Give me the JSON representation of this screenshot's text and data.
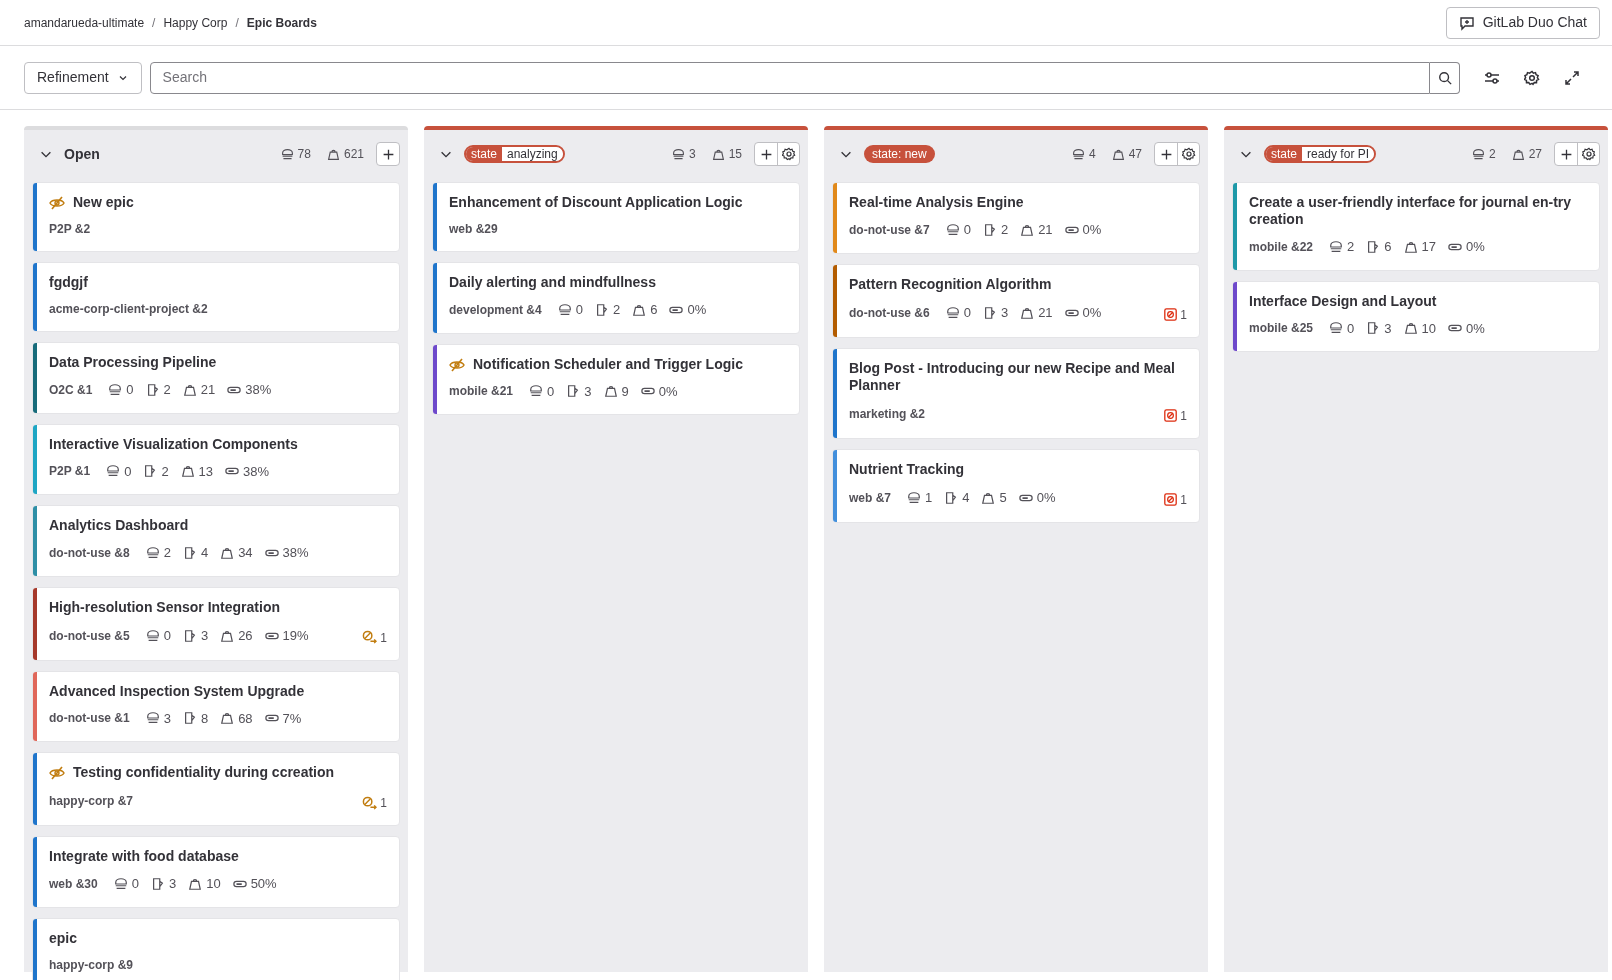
{
  "breadcrumbs": [
    {
      "label": "amandarueda-ultimate",
      "current": false
    },
    {
      "label": "Happy Corp",
      "current": false
    },
    {
      "label": "Epic Boards",
      "current": true
    }
  ],
  "breadcrumb_separator": "/",
  "duo_button": "GitLab Duo Chat",
  "board_selector": "Refinement",
  "search": {
    "placeholder": "Search"
  },
  "columns": [
    {
      "kind": "plain",
      "title": "Open",
      "expanded": true,
      "epics": "78",
      "weight": "621",
      "settings": false,
      "color": "#dcdcde",
      "cards": [
        {
          "title": "New epic",
          "confidential": true,
          "reference": "P2P &2",
          "color": "#1f75cb"
        },
        {
          "title": "fgdgjf",
          "confidential": false,
          "reference": "acme-corp-client-project &2",
          "color": "#1f75cb"
        },
        {
          "title": "Data Processing Pipeline",
          "confidential": false,
          "reference": "O2C &1",
          "stats": {
            "epics": "0",
            "issues": "2",
            "weight": "21",
            "progress": "38%"
          },
          "color": "#176b7a"
        },
        {
          "title": "Interactive Visualization Components",
          "confidential": false,
          "reference": "P2P &1",
          "stats": {
            "epics": "0",
            "issues": "2",
            "weight": "13",
            "progress": "38%"
          },
          "color": "#1ea6c4"
        },
        {
          "title": "Analytics Dashboard",
          "confidential": false,
          "reference": "do-not-use &8",
          "stats": {
            "epics": "2",
            "issues": "4",
            "weight": "34",
            "progress": "38%"
          },
          "color": "#2e8fa6"
        },
        {
          "title": "High-resolution Sensor Integration",
          "confidential": false,
          "reference": "do-not-use &5",
          "stats": {
            "epics": "0",
            "issues": "3",
            "weight": "26",
            "progress": "19%"
          },
          "badge": {
            "kind": "blocking",
            "count": "1"
          },
          "color": "#a6392b"
        },
        {
          "title": "Advanced Inspection System Upgrade",
          "confidential": false,
          "reference": "do-not-use &1",
          "stats": {
            "epics": "3",
            "issues": "8",
            "weight": "68",
            "progress": "7%"
          },
          "color": "#e0675a"
        },
        {
          "title": "Testing confidentiality during ccreation",
          "confidential": true,
          "reference": "happy-corp &7",
          "badge": {
            "kind": "blocking",
            "count": "1"
          },
          "color": "#1f75cb"
        },
        {
          "title": "Integrate with food database",
          "confidential": false,
          "reference": "web &30",
          "stats": {
            "epics": "0",
            "issues": "3",
            "weight": "10",
            "progress": "50%"
          },
          "color": "#1f75cb"
        },
        {
          "title": "epic",
          "confidential": false,
          "reference": "happy-corp &9",
          "color": "#1f75cb"
        }
      ]
    },
    {
      "kind": "scoped_label",
      "key": "state",
      "value": "analyzing",
      "expanded": true,
      "epics": "3",
      "weight": "15",
      "settings": true,
      "color": "#c7513c",
      "cards": [
        {
          "title": "Enhancement of Discount Application Logic",
          "confidential": false,
          "reference": "web &29",
          "color": "#1f75cb"
        },
        {
          "title": "Daily alerting and mindfullness",
          "confidential": false,
          "reference": "development &4",
          "stats": {
            "epics": "0",
            "issues": "2",
            "weight": "6",
            "progress": "0%"
          },
          "color": "#1f75cb"
        },
        {
          "title": "Notification Scheduler and Trigger Logic",
          "confidential": true,
          "reference": "mobile &21",
          "stats": {
            "epics": "0",
            "issues": "3",
            "weight": "9",
            "progress": "0%"
          },
          "color": "#6e49cb"
        }
      ]
    },
    {
      "kind": "label",
      "title": "state: new",
      "expanded": true,
      "epics": "4",
      "weight": "47",
      "settings": true,
      "color": "#c7513c",
      "cards": [
        {
          "title": "Real-time Analysis Engine",
          "confidential": false,
          "reference": "do-not-use &7",
          "stats": {
            "epics": "0",
            "issues": "2",
            "weight": "21",
            "progress": "0%"
          },
          "color": "#e1891a"
        },
        {
          "title": "Pattern Recognition Algorithm",
          "confidential": false,
          "reference": "do-not-use &6",
          "stats": {
            "epics": "0",
            "issues": "3",
            "weight": "21",
            "progress": "0%"
          },
          "badge": {
            "kind": "blocked",
            "count": "1"
          },
          "color": "#b35c00"
        },
        {
          "title": "Blog Post - Introducing our new Recipe and Meal Planner",
          "confidential": false,
          "reference": "marketing &2",
          "badge": {
            "kind": "blocked",
            "count": "1"
          },
          "color": "#1f75cb"
        },
        {
          "title": "Nutrient Tracking",
          "confidential": false,
          "reference": "web &7",
          "stats": {
            "epics": "1",
            "issues": "4",
            "weight": "5",
            "progress": "0%"
          },
          "badge": {
            "kind": "blocked",
            "count": "1"
          },
          "color": "#428fdc"
        }
      ]
    },
    {
      "kind": "scoped_label",
      "key": "state",
      "value": "ready for PI",
      "expanded": true,
      "epics": "2",
      "weight": "27",
      "settings": true,
      "color": "#c7513c",
      "cards": [
        {
          "title": "Create a user-friendly interface for journal en-try creation",
          "confidential": false,
          "reference": "mobile &22",
          "stats": {
            "epics": "2",
            "issues": "6",
            "weight": "17",
            "progress": "0%"
          },
          "color": "#1e99a8"
        },
        {
          "title": "Interface Design and Layout",
          "confidential": false,
          "reference": "mobile &25",
          "stats": {
            "epics": "0",
            "issues": "3",
            "weight": "10",
            "progress": "0%"
          },
          "color": "#6e49cb"
        }
      ]
    }
  ]
}
